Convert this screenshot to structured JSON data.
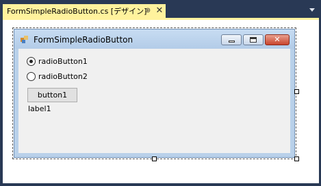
{
  "document_tab": {
    "title": "FormSimpleRadioButton.cs [デザイン]",
    "pin_glyph": "⊕",
    "close_glyph": "✕"
  },
  "form": {
    "title": "FormSimpleRadioButton",
    "title_buttons": {
      "close_glyph": "✕"
    }
  },
  "controls": {
    "radio1": {
      "label": "radioButton1",
      "checked": true
    },
    "radio2": {
      "label": "radioButton2",
      "checked": false
    },
    "button1": {
      "label": "button1"
    },
    "label1": {
      "text": "label1"
    }
  },
  "colors": {
    "ide_background": "#293955",
    "active_tab": "#fff29d",
    "form_frame": "#b9d1ea",
    "form_client": "#f0f0f0",
    "close_button": "#c8442c"
  },
  "icons": [
    "pin-icon",
    "close-icon",
    "dropdown-arrow-icon",
    "form-app-icon",
    "minimize-icon",
    "maximize-icon",
    "window-close-icon"
  ]
}
